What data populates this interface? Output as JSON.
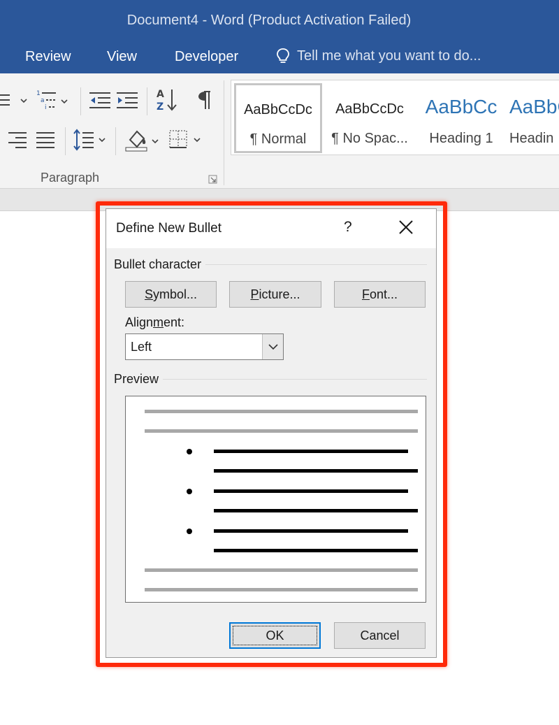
{
  "window": {
    "title": "Document4 - Word (Product Activation Failed)"
  },
  "tabs": [
    {
      "label": "Review"
    },
    {
      "label": "View"
    },
    {
      "label": "Developer"
    }
  ],
  "tell_me": {
    "placeholder": "Tell me what you want to do...",
    "icon": "lightbulb-icon"
  },
  "ribbon": {
    "paragraph_group_label": "Paragraph",
    "paragraph_icons": [
      "multilevel-list-icon",
      "decrease-indent-icon",
      "increase-indent-icon",
      "sort-icon",
      "show-formatting-marks-icon",
      "align-right-icon",
      "justify-icon",
      "line-spacing-icon",
      "shading-icon",
      "borders-icon"
    ],
    "styles": [
      {
        "sample": "AaBbCcDc",
        "name": "¶ Normal",
        "selected": true
      },
      {
        "sample": "AaBbCcDc",
        "name": "¶ No Spac..."
      },
      {
        "sample": "AaBbCc",
        "name": "Heading 1"
      },
      {
        "sample": "AaBbC",
        "name": "Headin"
      }
    ],
    "heading_color": "#2e74b5"
  },
  "dialog": {
    "title": "Define New Bullet",
    "help_label": "?",
    "bullet_character_label": "Bullet character",
    "buttons": {
      "symbol_prefix": "",
      "symbol_key": "S",
      "symbol_rest": "ymbol...",
      "picture_key": "P",
      "picture_rest": "icture...",
      "font_key": "F",
      "font_rest": "ont..."
    },
    "alignment": {
      "label_pre": "Align",
      "label_key": "m",
      "label_post": "ent:",
      "value": "Left"
    },
    "preview_label": "Preview",
    "ok_label": "OK",
    "cancel_label": "Cancel"
  },
  "colors": {
    "title_bar": "#2b579a",
    "highlight": "#ff2a0a",
    "ok_focus": "#0078d7"
  }
}
